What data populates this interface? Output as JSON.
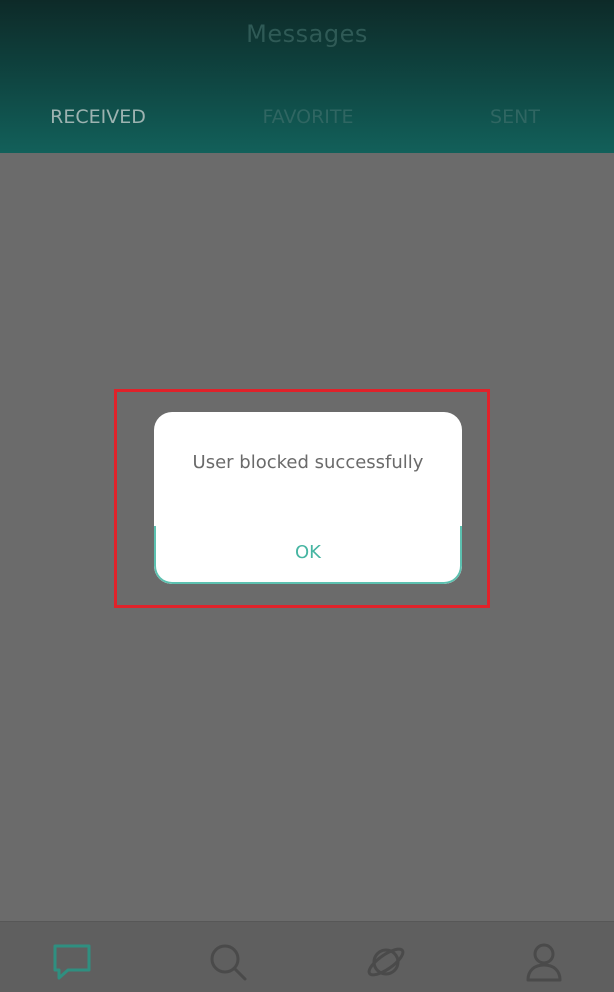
{
  "header": {
    "title": "Messages",
    "tabs": [
      {
        "label": "RECEIVED",
        "active": true
      },
      {
        "label": "FAVORITE",
        "active": false
      },
      {
        "label": "SENT",
        "active": false
      }
    ]
  },
  "dialog": {
    "message": "User blocked successfully",
    "ok_label": "OK"
  },
  "bottom_nav": {
    "items": [
      {
        "icon": "chat-bubble-icon",
        "active": true
      },
      {
        "icon": "search-icon",
        "active": false
      },
      {
        "icon": "planet-icon",
        "active": false
      },
      {
        "icon": "profile-icon",
        "active": false
      }
    ]
  },
  "colors": {
    "accent": "#46b5a2",
    "highlight": "#e0222a",
    "overlay": "#6b6b6b"
  }
}
